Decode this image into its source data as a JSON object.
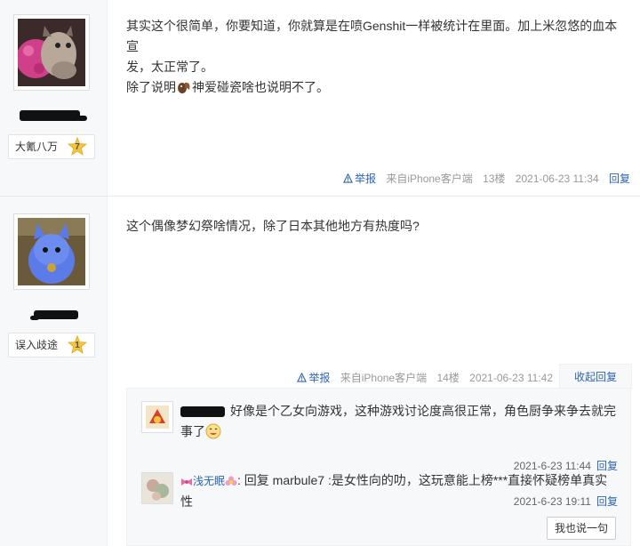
{
  "posts": [
    {
      "level_badge": "大氰八万",
      "level_number": "7",
      "content_line1": "其实这个很简单，你要知道，你就算是在喷Genshit一样被统计在里面。加上米忽悠的血本宣",
      "content_line2": "发，太正常了。",
      "content_line3a": "除了说明",
      "content_line3b": "神爱碰瓷啥也说明不了。",
      "report": "举报",
      "source": "来自iPhone客户端",
      "floor": "13楼",
      "time": "2021-06-23 11:34",
      "reply": "回复"
    },
    {
      "level_badge": "误入歧途",
      "level_number": "1",
      "content": "这个偶像梦幻祭啥情况，除了日本其他地方有热度吗?",
      "report": "举报",
      "source": "来自iPhone客户端",
      "floor": "14楼",
      "time": "2021-06-23 11:42",
      "collapse_reply": "收起回复"
    }
  ],
  "sub_replies": [
    {
      "text_line1": "好像是个乙女向游戏，这种游戏讨论度高很正常，角色厨争来争去就完",
      "text_line2": "事了",
      "time": "2021-6-23 11:44",
      "reply": "回复"
    },
    {
      "name": "浅无眠",
      "text": ": 回复 marbule7 :是女性向的叻，这玩意能上榜***直接怀疑榜单真实性",
      "time": "2021-6-23 19:11",
      "reply": "回复"
    }
  ],
  "say_button": "我也说一句",
  "colors": {
    "link": "#2d64b3",
    "sidebar_bg": "#f7f8fa",
    "badge_star": "#f5c542"
  }
}
